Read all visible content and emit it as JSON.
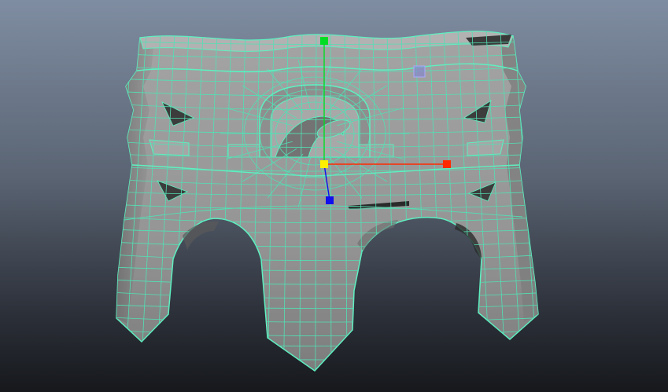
{
  "viewport": {
    "background_top": "#7f8da2",
    "background_bottom": "#16181c",
    "wireframe_color": "#52e0b4",
    "mesh_color": "#9a9a9a"
  },
  "manipulator": {
    "x_axis_color": "#ff2a00",
    "y_axis_color": "#00dd22",
    "z_axis_color": "#1010ee",
    "center_color": "#ffee00",
    "plane_handle_color": "#8888cc"
  }
}
